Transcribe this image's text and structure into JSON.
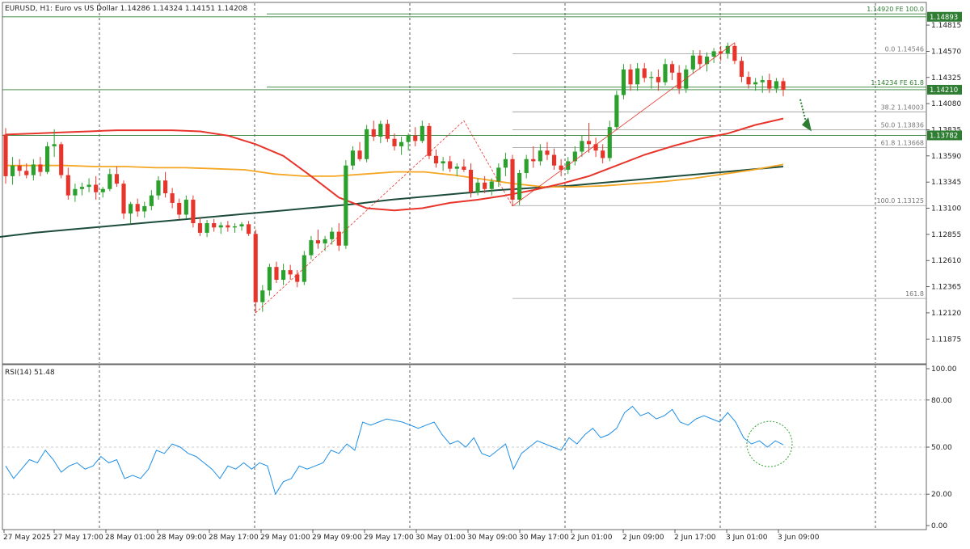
{
  "header": {
    "title": "EURUSD, H1:  Euro vs US Dollar  1.14286  1.14324  1.14151  1.14208"
  },
  "colors": {
    "bull": "#2ca02c",
    "bear": "#e8352b",
    "ma_red": "#e8352b",
    "ma_orange": "#f5a623",
    "ma_green": "#1d4d3a",
    "fib": "#999999",
    "hline": "#2e7d32",
    "rsi": "#1f8fe6"
  },
  "chart_data": {
    "type": "candlestick",
    "symbol": "EURUSD",
    "timeframe": "H1",
    "ylim": [
      1.1165,
      1.1502
    ],
    "price_ticks": [
      "1.14815",
      "1.14570",
      "1.14325",
      "1.14080",
      "1.13835",
      "1.13590",
      "1.13345",
      "1.13100",
      "1.12855",
      "1.12610",
      "1.12365",
      "1.12120",
      "1.11875"
    ],
    "time_labels": [
      "27 May 2025",
      "27 May 17:00",
      "28 May 01:00",
      "28 May 09:00",
      "28 May 17:00",
      "29 May 01:00",
      "29 May 09:00",
      "29 May 17:00",
      "30 May 01:00",
      "30 May 09:00",
      "30 May 17:00",
      "2 Jun 01:00",
      "2 Jun 09:00",
      "2 Jun 17:00",
      "3 Jun 01:00",
      "3 Jun 09:00"
    ],
    "candles": [
      [
        1.1379,
        1.1385,
        1.1333,
        1.134
      ],
      [
        1.134,
        1.1358,
        1.1332,
        1.135
      ],
      [
        1.135,
        1.1356,
        1.134,
        1.1345
      ],
      [
        1.1345,
        1.1352,
        1.1338,
        1.1341
      ],
      [
        1.1341,
        1.1356,
        1.1336,
        1.1351
      ],
      [
        1.1351,
        1.1358,
        1.134,
        1.1344
      ],
      [
        1.1344,
        1.1372,
        1.1342,
        1.1368
      ],
      [
        1.1368,
        1.1384,
        1.1358,
        1.137
      ],
      [
        1.137,
        1.1372,
        1.1338,
        1.1341
      ],
      [
        1.1341,
        1.1348,
        1.1318,
        1.1322
      ],
      [
        1.1322,
        1.1333,
        1.1316,
        1.1328
      ],
      [
        1.1328,
        1.1334,
        1.1322,
        1.133
      ],
      [
        1.133,
        1.1338,
        1.1325,
        1.1332
      ],
      [
        1.1332,
        1.134,
        1.1318,
        1.1325
      ],
      [
        1.1325,
        1.133,
        1.132,
        1.1328
      ],
      [
        1.1328,
        1.1347,
        1.1326,
        1.1342
      ],
      [
        1.1342,
        1.1349,
        1.133,
        1.1333
      ],
      [
        1.1333,
        1.1336,
        1.13,
        1.1305
      ],
      [
        1.1305,
        1.1316,
        1.1296,
        1.1314
      ],
      [
        1.1314,
        1.1319,
        1.1302,
        1.1307
      ],
      [
        1.1307,
        1.1316,
        1.1301,
        1.1312
      ],
      [
        1.1312,
        1.1327,
        1.1308,
        1.1322
      ],
      [
        1.1322,
        1.134,
        1.1318,
        1.1336
      ],
      [
        1.1336,
        1.1344,
        1.132,
        1.1324
      ],
      [
        1.1324,
        1.1329,
        1.131,
        1.1315
      ],
      [
        1.1315,
        1.1319,
        1.13,
        1.1304
      ],
      [
        1.1304,
        1.1322,
        1.13,
        1.1318
      ],
      [
        1.1318,
        1.1322,
        1.1292,
        1.1296
      ],
      [
        1.1296,
        1.1301,
        1.1284,
        1.1287
      ],
      [
        1.1287,
        1.1299,
        1.1283,
        1.1296
      ],
      [
        1.1296,
        1.13,
        1.1288,
        1.1292
      ],
      [
        1.1292,
        1.1297,
        1.1286,
        1.1294
      ],
      [
        1.1294,
        1.1298,
        1.1288,
        1.1292
      ],
      [
        1.1292,
        1.1296,
        1.1287,
        1.1293
      ],
      [
        1.1293,
        1.1297,
        1.1289,
        1.1295
      ],
      [
        1.1295,
        1.1298,
        1.1284,
        1.1286
      ],
      [
        1.1286,
        1.129,
        1.1212,
        1.1222
      ],
      [
        1.1222,
        1.1238,
        1.1213,
        1.1233
      ],
      [
        1.1233,
        1.1258,
        1.1228,
        1.1255
      ],
      [
        1.1255,
        1.126,
        1.124,
        1.1243
      ],
      [
        1.1243,
        1.1258,
        1.1238,
        1.1252
      ],
      [
        1.1252,
        1.1257,
        1.1243,
        1.1248
      ],
      [
        1.1248,
        1.1252,
        1.1236,
        1.1241
      ],
      [
        1.1241,
        1.127,
        1.1238,
        1.1266
      ],
      [
        1.1266,
        1.1284,
        1.1262,
        1.128
      ],
      [
        1.128,
        1.129,
        1.1272,
        1.1277
      ],
      [
        1.1277,
        1.1284,
        1.127,
        1.1281
      ],
      [
        1.1281,
        1.1292,
        1.1276,
        1.1288
      ],
      [
        1.1288,
        1.1296,
        1.127,
        1.1275
      ],
      [
        1.1275,
        1.1355,
        1.1272,
        1.135
      ],
      [
        1.135,
        1.1368,
        1.1346,
        1.1364
      ],
      [
        1.1364,
        1.1372,
        1.1354,
        1.1356
      ],
      [
        1.1356,
        1.1388,
        1.1353,
        1.1384
      ],
      [
        1.1384,
        1.1392,
        1.1373,
        1.1377
      ],
      [
        1.1377,
        1.1392,
        1.1371,
        1.1389
      ],
      [
        1.1389,
        1.1393,
        1.1372,
        1.1375
      ],
      [
        1.1375,
        1.138,
        1.1364,
        1.1368
      ],
      [
        1.1368,
        1.1377,
        1.136,
        1.1372
      ],
      [
        1.1372,
        1.138,
        1.1364,
        1.1378
      ],
      [
        1.1378,
        1.1386,
        1.1368,
        1.1373
      ],
      [
        1.1373,
        1.1392,
        1.1371,
        1.1387
      ],
      [
        1.1387,
        1.139,
        1.1356,
        1.1359
      ],
      [
        1.1359,
        1.1365,
        1.1348,
        1.1352
      ],
      [
        1.1352,
        1.1358,
        1.1345,
        1.1354
      ],
      [
        1.1354,
        1.1359,
        1.1344,
        1.1347
      ],
      [
        1.1347,
        1.1352,
        1.134,
        1.1349
      ],
      [
        1.1349,
        1.1356,
        1.1344,
        1.1346
      ],
      [
        1.1346,
        1.1352,
        1.132,
        1.1325
      ],
      [
        1.1325,
        1.1338,
        1.1322,
        1.1334
      ],
      [
        1.1334,
        1.134,
        1.1324,
        1.1328
      ],
      [
        1.1328,
        1.1338,
        1.1322,
        1.1335
      ],
      [
        1.1335,
        1.1352,
        1.133,
        1.1348
      ],
      [
        1.1348,
        1.1362,
        1.134,
        1.1356
      ],
      [
        1.1356,
        1.136,
        1.1312,
        1.1318
      ],
      [
        1.1318,
        1.1346,
        1.1313,
        1.1343
      ],
      [
        1.1343,
        1.136,
        1.1338,
        1.1356
      ],
      [
        1.1356,
        1.1368,
        1.1348,
        1.1354
      ],
      [
        1.1354,
        1.137,
        1.135,
        1.1364
      ],
      [
        1.1364,
        1.1372,
        1.1355,
        1.136
      ],
      [
        1.136,
        1.1366,
        1.1346,
        1.135
      ],
      [
        1.135,
        1.1356,
        1.134,
        1.1346
      ],
      [
        1.1346,
        1.1358,
        1.1342,
        1.1354
      ],
      [
        1.1354,
        1.1368,
        1.135,
        1.1363
      ],
      [
        1.1363,
        1.1378,
        1.1358,
        1.1373
      ],
      [
        1.1373,
        1.139,
        1.1362,
        1.137
      ],
      [
        1.137,
        1.1376,
        1.1358,
        1.1364
      ],
      [
        1.1364,
        1.137,
        1.1352,
        1.1357
      ],
      [
        1.1357,
        1.1392,
        1.1354,
        1.1386
      ],
      [
        1.1386,
        1.142,
        1.1383,
        1.1416
      ],
      [
        1.1416,
        1.1445,
        1.1412,
        1.144
      ],
      [
        1.144,
        1.1445,
        1.142,
        1.1426
      ],
      [
        1.1426,
        1.1446,
        1.142,
        1.1441
      ],
      [
        1.1441,
        1.1446,
        1.1428,
        1.1432
      ],
      [
        1.1432,
        1.1438,
        1.1422,
        1.1433
      ],
      [
        1.1433,
        1.144,
        1.142,
        1.1428
      ],
      [
        1.1428,
        1.145,
        1.1425,
        1.1445
      ],
      [
        1.1445,
        1.1448,
        1.143,
        1.1437
      ],
      [
        1.1437,
        1.1444,
        1.1417,
        1.1422
      ],
      [
        1.1422,
        1.1444,
        1.1418,
        1.144
      ],
      [
        1.144,
        1.1458,
        1.1436,
        1.1453
      ],
      [
        1.1453,
        1.1458,
        1.144,
        1.1445
      ],
      [
        1.1445,
        1.1456,
        1.1438,
        1.1452
      ],
      [
        1.1452,
        1.146,
        1.1446,
        1.1457
      ],
      [
        1.1457,
        1.1462,
        1.1448,
        1.1455
      ],
      [
        1.1455,
        1.1465,
        1.145,
        1.1462
      ],
      [
        1.1462,
        1.1465,
        1.1445,
        1.1448
      ],
      [
        1.1448,
        1.1452,
        1.1428,
        1.1433
      ],
      [
        1.1433,
        1.1438,
        1.1422,
        1.1426
      ],
      [
        1.1426,
        1.1432,
        1.142,
        1.1428
      ],
      [
        1.1428,
        1.1434,
        1.1418,
        1.143
      ],
      [
        1.143,
        1.1436,
        1.1418,
        1.1422
      ],
      [
        1.1422,
        1.1432,
        1.1418,
        1.1429
      ],
      [
        1.1429,
        1.1432,
        1.1415,
        1.1421
      ]
    ],
    "ma_red": [
      1.1379,
      1.138,
      1.1381,
      1.1382,
      1.1383,
      1.1383,
      1.1383,
      1.1382,
      1.1378,
      1.137,
      1.1359,
      1.134,
      1.132,
      1.131,
      1.1308,
      1.131,
      1.1315,
      1.1318,
      1.1322,
      1.1327,
      1.1333,
      1.134,
      1.135,
      1.136,
      1.1368,
      1.1375,
      1.138,
      1.1388,
      1.1394
    ],
    "ma_orange": [
      1.135,
      1.135,
      1.135,
      1.1349,
      1.1349,
      1.1348,
      1.1348,
      1.1347,
      1.1346,
      1.1342,
      1.134,
      1.134,
      1.1342,
      1.1344,
      1.1344,
      1.1341,
      1.1337,
      1.1333,
      1.133,
      1.133,
      1.1331,
      1.1333,
      1.1335,
      1.1338,
      1.1342,
      1.1346,
      1.1351
    ],
    "ma_green": [
      1.1283,
      1.1287,
      1.129,
      1.1293,
      1.1296,
      1.1299,
      1.1302,
      1.1305,
      1.1308,
      1.1311,
      1.1314,
      1.1318,
      1.1321,
      1.1324,
      1.1327,
      1.1329,
      1.1331,
      1.1334,
      1.1337,
      1.134,
      1.1343,
      1.1346,
      1.1349
    ],
    "price_labels": [
      {
        "value": 1.14893,
        "label": "1.14893"
      },
      {
        "value": 1.1421,
        "label": "1.14210"
      },
      {
        "value": 1.13782,
        "label": "1.13782"
      }
    ],
    "fib_levels": [
      {
        "value": 1.14546,
        "label": "0.0  1.14546"
      },
      {
        "value": 1.14003,
        "label": "38.2  1.14003"
      },
      {
        "value": 1.13836,
        "label": "50.0  1.13836"
      },
      {
        "value": 1.13668,
        "label": "61.8  1.13668"
      },
      {
        "value": 1.13125,
        "label": "100.0  1.13125"
      },
      {
        "value": 1.12255,
        "label": "161.8"
      }
    ],
    "fe_levels": [
      {
        "value": 1.1492,
        "label": "1.14920  FE 100.0"
      },
      {
        "value": 1.14234,
        "label": "1.14234  FE 61.8"
      }
    ],
    "rsi": {
      "label": "RSI(14) 51.48",
      "ylim": [
        0,
        100
      ],
      "ticks": [
        "100.00",
        "80.00",
        "50.00",
        "20.00",
        "0.00"
      ],
      "levels": [
        80,
        50,
        20
      ],
      "values": [
        38,
        30,
        36,
        42,
        40,
        48,
        42,
        34,
        38,
        40,
        36,
        38,
        44,
        40,
        42,
        30,
        32,
        30,
        36,
        48,
        46,
        52,
        50,
        46,
        44,
        40,
        36,
        30,
        38,
        36,
        40,
        36,
        40,
        38,
        20,
        28,
        30,
        38,
        36,
        38,
        40,
        48,
        46,
        52,
        48,
        66,
        64,
        66,
        68,
        67,
        66,
        64,
        62,
        64,
        66,
        58,
        52,
        54,
        50,
        56,
        46,
        44,
        48,
        52,
        36,
        46,
        50,
        54,
        52,
        50,
        48,
        56,
        52,
        58,
        62,
        56,
        58,
        62,
        72,
        76,
        70,
        72,
        68,
        70,
        74,
        66,
        64,
        68,
        70,
        68,
        66,
        72,
        66,
        56,
        52,
        54,
        50,
        54,
        51.48
      ]
    }
  }
}
